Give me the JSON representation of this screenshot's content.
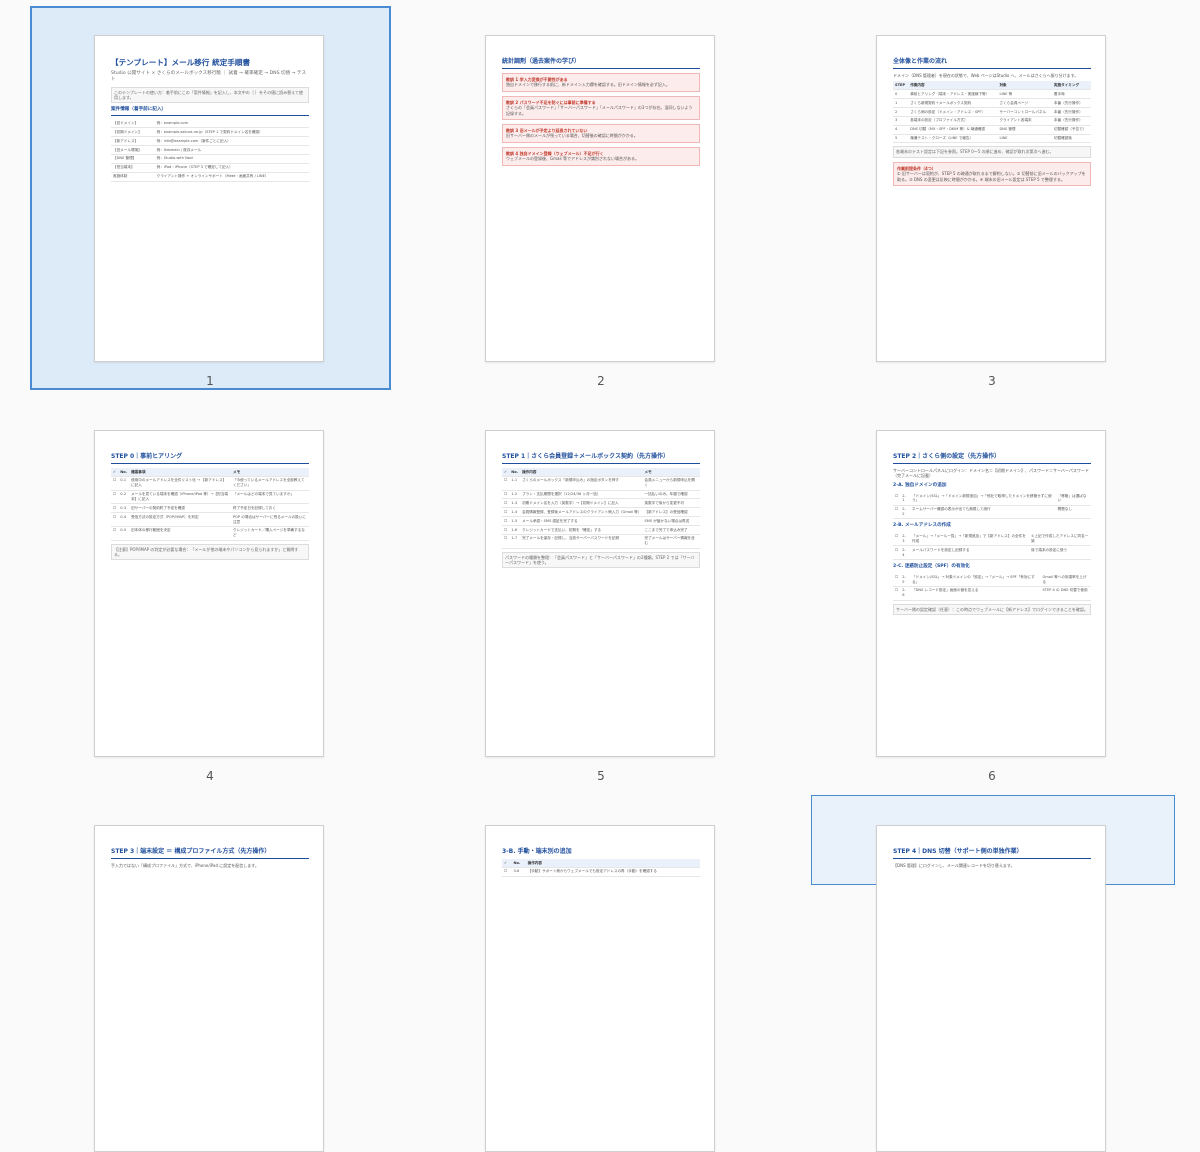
{
  "pages": [
    {
      "number": "1",
      "state": "selected",
      "title": "【テンプレート】メール移行 統定手順書",
      "subtitle": "Studio 公開サイト × さくらのメールボックス移行版 ｜ 試着 → 確率確定 → DNS 切替 → テスト",
      "intro": "このテンプレートの使い方：着手前にこの「案件情報」を記入し、本文中の｛ ｝をその値に読み替えて使用します。",
      "section": "案件情報（着手前に記入）",
      "rows": [
        {
          "k": "【旧ドメイン】",
          "v": "例：example.com"
        },
        {
          "k": "【初期ドメイン】",
          "v": "例：example.sakura.ne.jp（STEP 1 で契約ドメイン名を確認）"
        },
        {
          "k": "【新アドレス】",
          "v": "例：info@example.com（案件ごとに記入）"
        },
        {
          "k": "【旧メール環境】",
          "v": "例：Xdomain / 既存メール"
        },
        {
          "k": "【DNS 管理】",
          "v": "例：Studio.with Navi"
        },
        {
          "k": "【担当端末】",
          "v": "例：iPad・iPhone（STEP 3 で確定して記入）"
        },
        {
          "k": "実施体制",
          "v": "クライアント操作 + オンラインサポート（Meet・画面共有 / LINE）"
        }
      ]
    },
    {
      "number": "2",
      "state": "normal",
      "title": "統計調剤（過去案件の学び）",
      "items": [
        {
          "head": "教訓 1  学入力変換が不要性がある",
          "body": "独自ドメインで移行する前に、新ドメイン入力欄を確認する。旧ドメイン情報を必ず記入。"
        },
        {
          "head": "教訓 2  パスワード不足を防ぐには事前に準備する",
          "body": "さくらの「会員パスワード」「サーバーパスワード」「メールパスワード」の3つが存在。混同しないよう記録する。"
        },
        {
          "head": "教訓 3  旧メールが予定より延長されていない",
          "body": "旧サーバー側のメールが残っている場合、切替後の確認に時間がかかる。"
        },
        {
          "head": "教訓 4  独自ドメイン登録（ウェブメール）不足が行く",
          "body": "ウェブメールの登録後、Gmail 等でアドレスが識別されない場合がある。"
        }
      ]
    },
    {
      "number": "3",
      "state": "normal",
      "title": "全体像と作業の流れ",
      "intro": "ドメイン（DNS 管理者）を現在の状態で、Web ページはStudio へ、メールはさくらへ振り分けます。",
      "cols": [
        "STEP",
        "作業内容",
        "対象",
        "実施タイミング"
      ],
      "rows": [
        [
          "0",
          "事前ヒアリング（端末・アドレス・実施線下等）",
          "LINE 等",
          "着手時"
        ],
        [
          "1",
          "さくら新規契約＋メールボックス契約",
          "さくら会員ページ",
          "本番（先行操作）"
        ],
        [
          "2",
          "さくら側の設定（ドメイン・アドレス・SPF）",
          "サーバーコントロールパネル",
          "本番（先行操作）"
        ],
        [
          "3",
          "各端末の設定（プロファイル方式）",
          "クライアント各端末",
          "本番（先行操作）"
        ],
        [
          "4",
          "DNS 切替（MX・SPF・DKIM 等）& 疎通確認",
          "DNS 管理",
          "切替確認（予告で）"
        ],
        [
          "5",
          "疎通テスト・クローズ（LINE で報告）",
          "LINE",
          "切替確認後"
        ]
      ],
      "note": "各端末のテスト設定は下記を参照。STEP 0〜5 の順に進め、確認が取れ次第次へ進む。",
      "warn_head": "作業前提条件（4つ）",
      "warn": "① 旧サーバーは契約が、STEP 5 の疎通が取れるまで解約しない。② 切替前に旧メールのバックアップを取る。③ DNS の変更は反映に時間がかかる。④ 端末の旧メール設定は STEP 5 で整理する。"
    },
    {
      "number": "4",
      "state": "normal",
      "title": "STEP 0｜事前ヒアリング",
      "cols": [
        "✓",
        "No.",
        "確認事項",
        "メモ"
      ],
      "rows": [
        [
          "☐",
          "0-1",
          "使用中のメールアドレスを全件リスト化 → 【新アドレス】に記入",
          "「今使っているメールアドレスを全部教えてください」"
        ],
        [
          "☐",
          "0-2",
          "メールを見ている端末を確認（iPhone/iPad 等）→【担当端末】に記入",
          "「メールはどの端末で見ていますか」"
        ],
        [
          "☐",
          "0-3",
          "旧サーバーの契約終了予定を確認",
          "終了予定日を記録しておく"
        ],
        [
          "☐",
          "0-4",
          "受信方法の設定方式（POP/IMAP）を判定",
          "POP の場合はサーバーに残るメールの扱いに注意"
        ],
        [
          "☐",
          "0-5",
          "旧本体の移行範囲を決定",
          "クレジットカード／購入ページを準備するなど"
        ]
      ],
      "note": "【注意】POP/IMAP の判定が必要な場合：「メールが他の端末やパソコンから見られますか」と質問する。"
    },
    {
      "number": "5",
      "state": "normal",
      "title": "STEP 1｜さくら会員登録＋メールボックス契約（先方操作）",
      "cols": [
        "✓",
        "No.",
        "操作内容",
        "メモ"
      ],
      "rows": [
        [
          "☐",
          "1-1",
          "さくらのメールボックス「新規申込み」の指定ボタンを押す",
          "会員メニューから新規申込を開く"
        ],
        [
          "☐",
          "1-2",
          "プラン・支払期間を選択（12/24/36 ヶ月一括）",
          "一括払いのみ。年額で確認"
        ],
        [
          "☐",
          "1-3",
          "初期ドメイン名を入力（英数字）→【初期ドメイン】に記入",
          "英数字で後から変更不可"
        ],
        [
          "☐",
          "1-4",
          "会員情報登録、登録後メールアドレスのクライアント側入力（Gmail 等）",
          "【新アドレス】の受信確認"
        ],
        [
          "☐",
          "1-5",
          "メール承認・SMS 認証を完了する",
          "SMS が届かない場合は再送"
        ],
        [
          "☐",
          "1-6",
          "クレジットカードで支払い、初期を「確定」する",
          "ここまで完了で申込み完了"
        ],
        [
          "☐",
          "1-7",
          "完了メールを保存・記録し、当該サーバーパスワードを記録",
          "完了メールはサーバー情報を含む"
        ]
      ],
      "note": "パスワードの種類を整理：「会員パスワード」と「サーバーパスワード」の2種類。STEP 2 では「サーバーパスワード」を使う。"
    },
    {
      "number": "6",
      "state": "normal",
      "title": "STEP 2｜さくら側の設定（先方操作）",
      "intro": "サーバーコントロールパネルにログイン：ドメイン名＝【初期ドメイン】、パスワード＝サーバーパスワード（完了メールに記載）",
      "sections": [
        {
          "name": "2-A. 独自ドメインの追加",
          "rows": [
            [
              "☐",
              "2-1",
              "「ドメイン/SSL」→「ドメイン新規追加」→「他社で取得したドメインを移管せずに使う」",
              "「移管」は選ばない"
            ],
            [
              "☐",
              "2-2",
              "ネームサーバー確認の表示が出ても無視して続行",
              "問題なし"
            ]
          ]
        },
        {
          "name": "2-B. メールアドレスの作成",
          "rows": [
            [
              "☐",
              "2-3",
              "「メール」→「メール一覧」→「新規追加」で【新アドレス】の全件を作成",
              "①上記で作成したアドレスに同名一致"
            ],
            [
              "☐",
              "2-4",
              "メールパスワードを設定し記録する",
              "後で端末の設定に使う"
            ]
          ]
        },
        {
          "name": "2-C. 迷惑防止設定（SPF）の有効化",
          "rows": [
            [
              "☐",
              "2-5",
              "「ドメイン/SSL」→ 対象ドメインの「設定」→「メール」→ SPF「有効にする」",
              "Gmail 等への到達率を上げる"
            ],
            [
              "☐",
              "2-6",
              "「DNS レコード設定」画面の値を控える",
              "STEP 4 の DNS 切替で使用"
            ]
          ]
        }
      ],
      "note": "サーバー側の設定確認（任意）：この時点でウェブメールに【新アドレス】でログインできることを確認。"
    },
    {
      "number": "7",
      "state": "normal",
      "title": "STEP 3｜端末設定 ＝ 構成プロファイル方式（先方操作）",
      "intro": "手入力ではない「構成プロファイル」方式で、iPhone/iPad に設定を配信します。"
    },
    {
      "number": "8",
      "state": "normal",
      "title": "3-B. 手動・端末別の追加",
      "cols": [
        "✓",
        "No.",
        "操作内容"
      ],
      "rows": [
        [
          "☐",
          "3-6",
          "【手動】サポート側からウェブメールでも設定アドレスの再（手動）を確認する"
        ]
      ]
    },
    {
      "number": "9",
      "state": "hover",
      "title": "STEP 4｜DNS 切替（サポート側の単独作業）",
      "intro": "【DNS 管理】にログインし、メール関連レコードを切り替えます。"
    }
  ]
}
